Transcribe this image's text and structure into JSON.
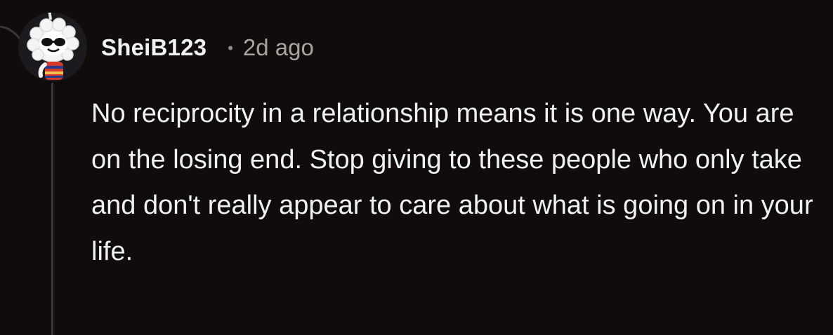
{
  "comment": {
    "username": "SheiB123",
    "separator": "•",
    "timestamp": "2d ago",
    "body": "No reciprocity in a relationship means it is one way. You are on the losing end. Stop giving to these people who only take and don't really appear to care about what is going on in your life."
  },
  "avatar": {
    "icon": "snoo-avatar-icon",
    "background": "#1c1a1e"
  },
  "colors": {
    "background": "#0f0c0b",
    "username": "#f2f2f2",
    "meta": "#a8a4a1",
    "thread_line": "#3a3634",
    "body_text": "#f1f1f1"
  }
}
